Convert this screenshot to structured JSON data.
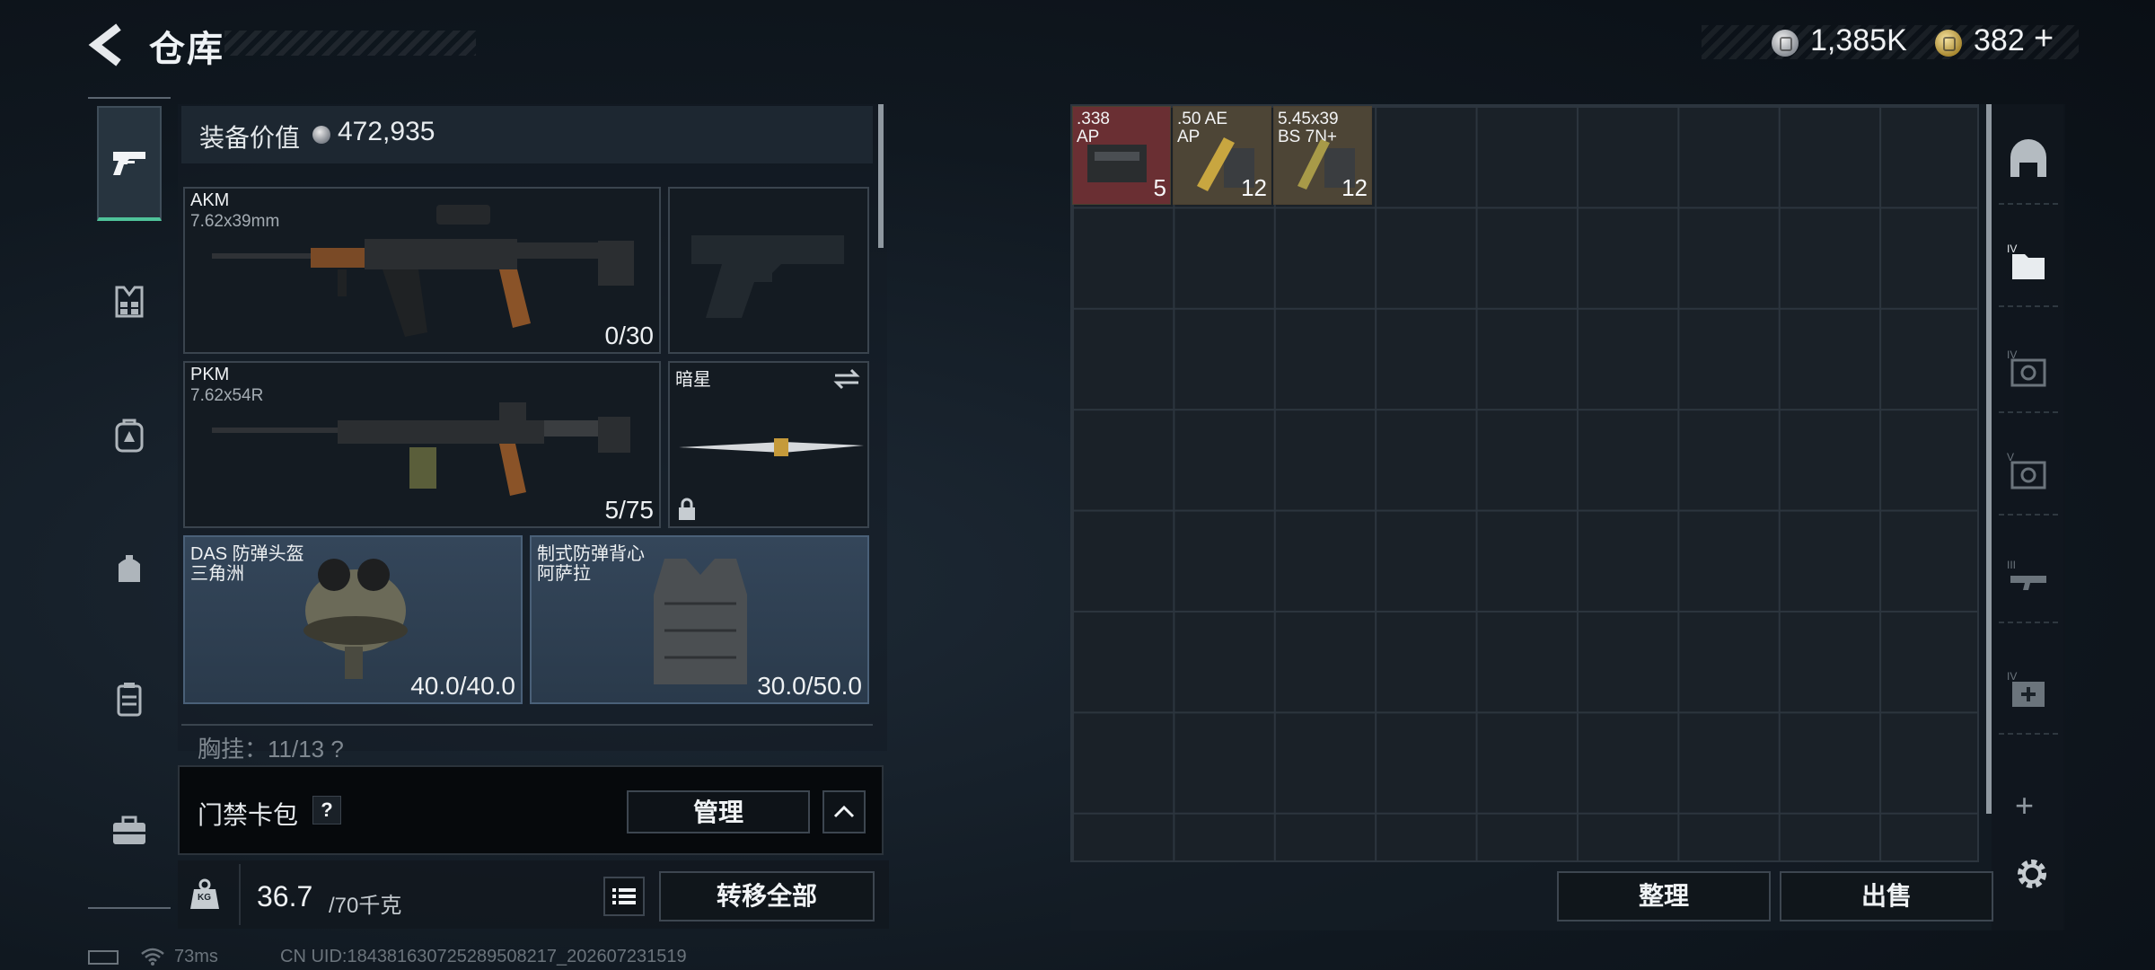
{
  "header": {
    "title": "仓库",
    "currency_silver": "1,385K",
    "currency_gold": "382"
  },
  "loadout": {
    "equip_value_label": "装备价值",
    "equip_value": "472,935",
    "primary": {
      "name": "AKM",
      "caliber": "7.62x39mm",
      "ammo": "0/30"
    },
    "secondary": {
      "name": "PKM",
      "caliber": "7.62x54R",
      "ammo": "5/75"
    },
    "melee": {
      "name": "暗星"
    },
    "helmet": {
      "name": "DAS 防弹头盔",
      "faction": "三角洲",
      "durability": "40.0/40.0"
    },
    "armor": {
      "name": "制式防弹背心",
      "faction": "阿萨拉",
      "durability": "30.0/50.0"
    },
    "chest_rig": "胸挂：11/13 ?",
    "keycard_label": "门禁卡包",
    "keycard_help": "?",
    "manage_label": "管理",
    "weight_current": "36.7",
    "weight_max": "/70千克",
    "weight_icon_text": "KG",
    "transfer_all_label": "转移全部"
  },
  "storage": {
    "items": [
      {
        "caliber": ".338",
        "type": "AP",
        "qty": "5",
        "bg": "#6a2f33"
      },
      {
        "caliber": ".50 AE",
        "type": "AP",
        "qty": "12",
        "bg": "#4d4536"
      },
      {
        "caliber": "5.45x39",
        "type": "BS 7N+",
        "qty": "12",
        "bg": "#4d4536"
      }
    ],
    "side_tab_labels": [
      "",
      "IV",
      "IV",
      "V",
      "III",
      "IV"
    ],
    "sort_label": "整理",
    "sell_label": "出售"
  },
  "status": {
    "ping": "73ms",
    "uid": "CN UID:18438163072528950​8217_202607231519"
  },
  "colors": {
    "accent_green": "#4fc39a",
    "panel_blue": "#34465a",
    "ammo_red": "#6a2f33"
  }
}
